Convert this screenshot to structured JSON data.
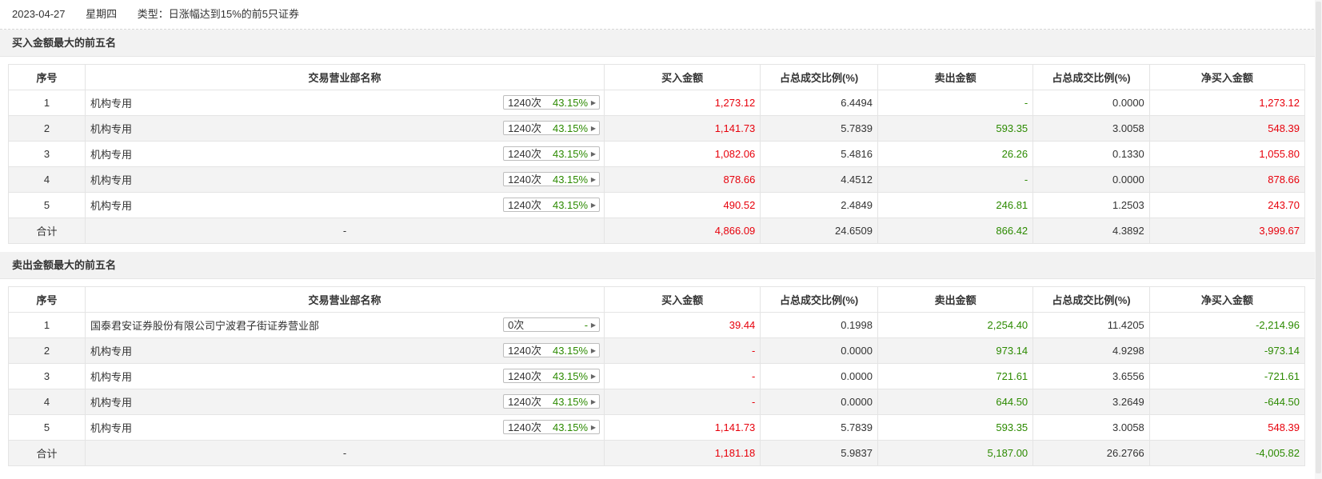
{
  "header": {
    "date": "2023-04-27",
    "weekday": "星期四",
    "type_label": "类型：日涨幅达到15%的前5只证券"
  },
  "columns": [
    "序号",
    "交易营业部名称",
    "买入金额",
    "占总成交比例(%)",
    "卖出金额",
    "占总成交比例(%)",
    "净买入金额"
  ],
  "buy_section": {
    "title": "买入金额最大的前五名",
    "rows": [
      {
        "idx": "1",
        "name": "机构专用",
        "count": "1240次",
        "pct": "43.15%",
        "buy": "1,273.12",
        "buy_ratio": "6.4494",
        "sell": "-",
        "sell_ratio": "0.0000",
        "net": "1,273.12"
      },
      {
        "idx": "2",
        "name": "机构专用",
        "count": "1240次",
        "pct": "43.15%",
        "buy": "1,141.73",
        "buy_ratio": "5.7839",
        "sell": "593.35",
        "sell_ratio": "3.0058",
        "net": "548.39"
      },
      {
        "idx": "3",
        "name": "机构专用",
        "count": "1240次",
        "pct": "43.15%",
        "buy": "1,082.06",
        "buy_ratio": "5.4816",
        "sell": "26.26",
        "sell_ratio": "0.1330",
        "net": "1,055.80"
      },
      {
        "idx": "4",
        "name": "机构专用",
        "count": "1240次",
        "pct": "43.15%",
        "buy": "878.66",
        "buy_ratio": "4.4512",
        "sell": "-",
        "sell_ratio": "0.0000",
        "net": "878.66"
      },
      {
        "idx": "5",
        "name": "机构专用",
        "count": "1240次",
        "pct": "43.15%",
        "buy": "490.52",
        "buy_ratio": "2.4849",
        "sell": "246.81",
        "sell_ratio": "1.2503",
        "net": "243.70"
      }
    ],
    "total": {
      "label": "合计",
      "name": "-",
      "buy": "4,866.09",
      "buy_ratio": "24.6509",
      "sell": "866.42",
      "sell_ratio": "4.3892",
      "net": "3,999.67"
    }
  },
  "sell_section": {
    "title": "卖出金额最大的前五名",
    "rows": [
      {
        "idx": "1",
        "name": "国泰君安证券股份有限公司宁波君子街证券营业部",
        "count": "0次",
        "pct": "-",
        "buy": "39.44",
        "buy_ratio": "0.1998",
        "sell": "2,254.40",
        "sell_ratio": "11.4205",
        "net": "-2,214.96"
      },
      {
        "idx": "2",
        "name": "机构专用",
        "count": "1240次",
        "pct": "43.15%",
        "buy": "-",
        "buy_ratio": "0.0000",
        "sell": "973.14",
        "sell_ratio": "4.9298",
        "net": "-973.14"
      },
      {
        "idx": "3",
        "name": "机构专用",
        "count": "1240次",
        "pct": "43.15%",
        "buy": "-",
        "buy_ratio": "0.0000",
        "sell": "721.61",
        "sell_ratio": "3.6556",
        "net": "-721.61"
      },
      {
        "idx": "4",
        "name": "机构专用",
        "count": "1240次",
        "pct": "43.15%",
        "buy": "-",
        "buy_ratio": "0.0000",
        "sell": "644.50",
        "sell_ratio": "3.2649",
        "net": "-644.50"
      },
      {
        "idx": "5",
        "name": "机构专用",
        "count": "1240次",
        "pct": "43.15%",
        "buy": "1,141.73",
        "buy_ratio": "5.7839",
        "sell": "593.35",
        "sell_ratio": "3.0058",
        "net": "548.39"
      }
    ],
    "total": {
      "label": "合计",
      "name": "-",
      "buy": "1,181.18",
      "buy_ratio": "5.9837",
      "sell": "5,187.00",
      "sell_ratio": "26.2766",
      "net": "-4,005.82"
    }
  },
  "colors": {
    "positive": "#e7000b",
    "negative": "#2c8a00",
    "stripe": "#f3f3f3"
  },
  "icons": {
    "badge_arrow": "caret-right-icon"
  }
}
